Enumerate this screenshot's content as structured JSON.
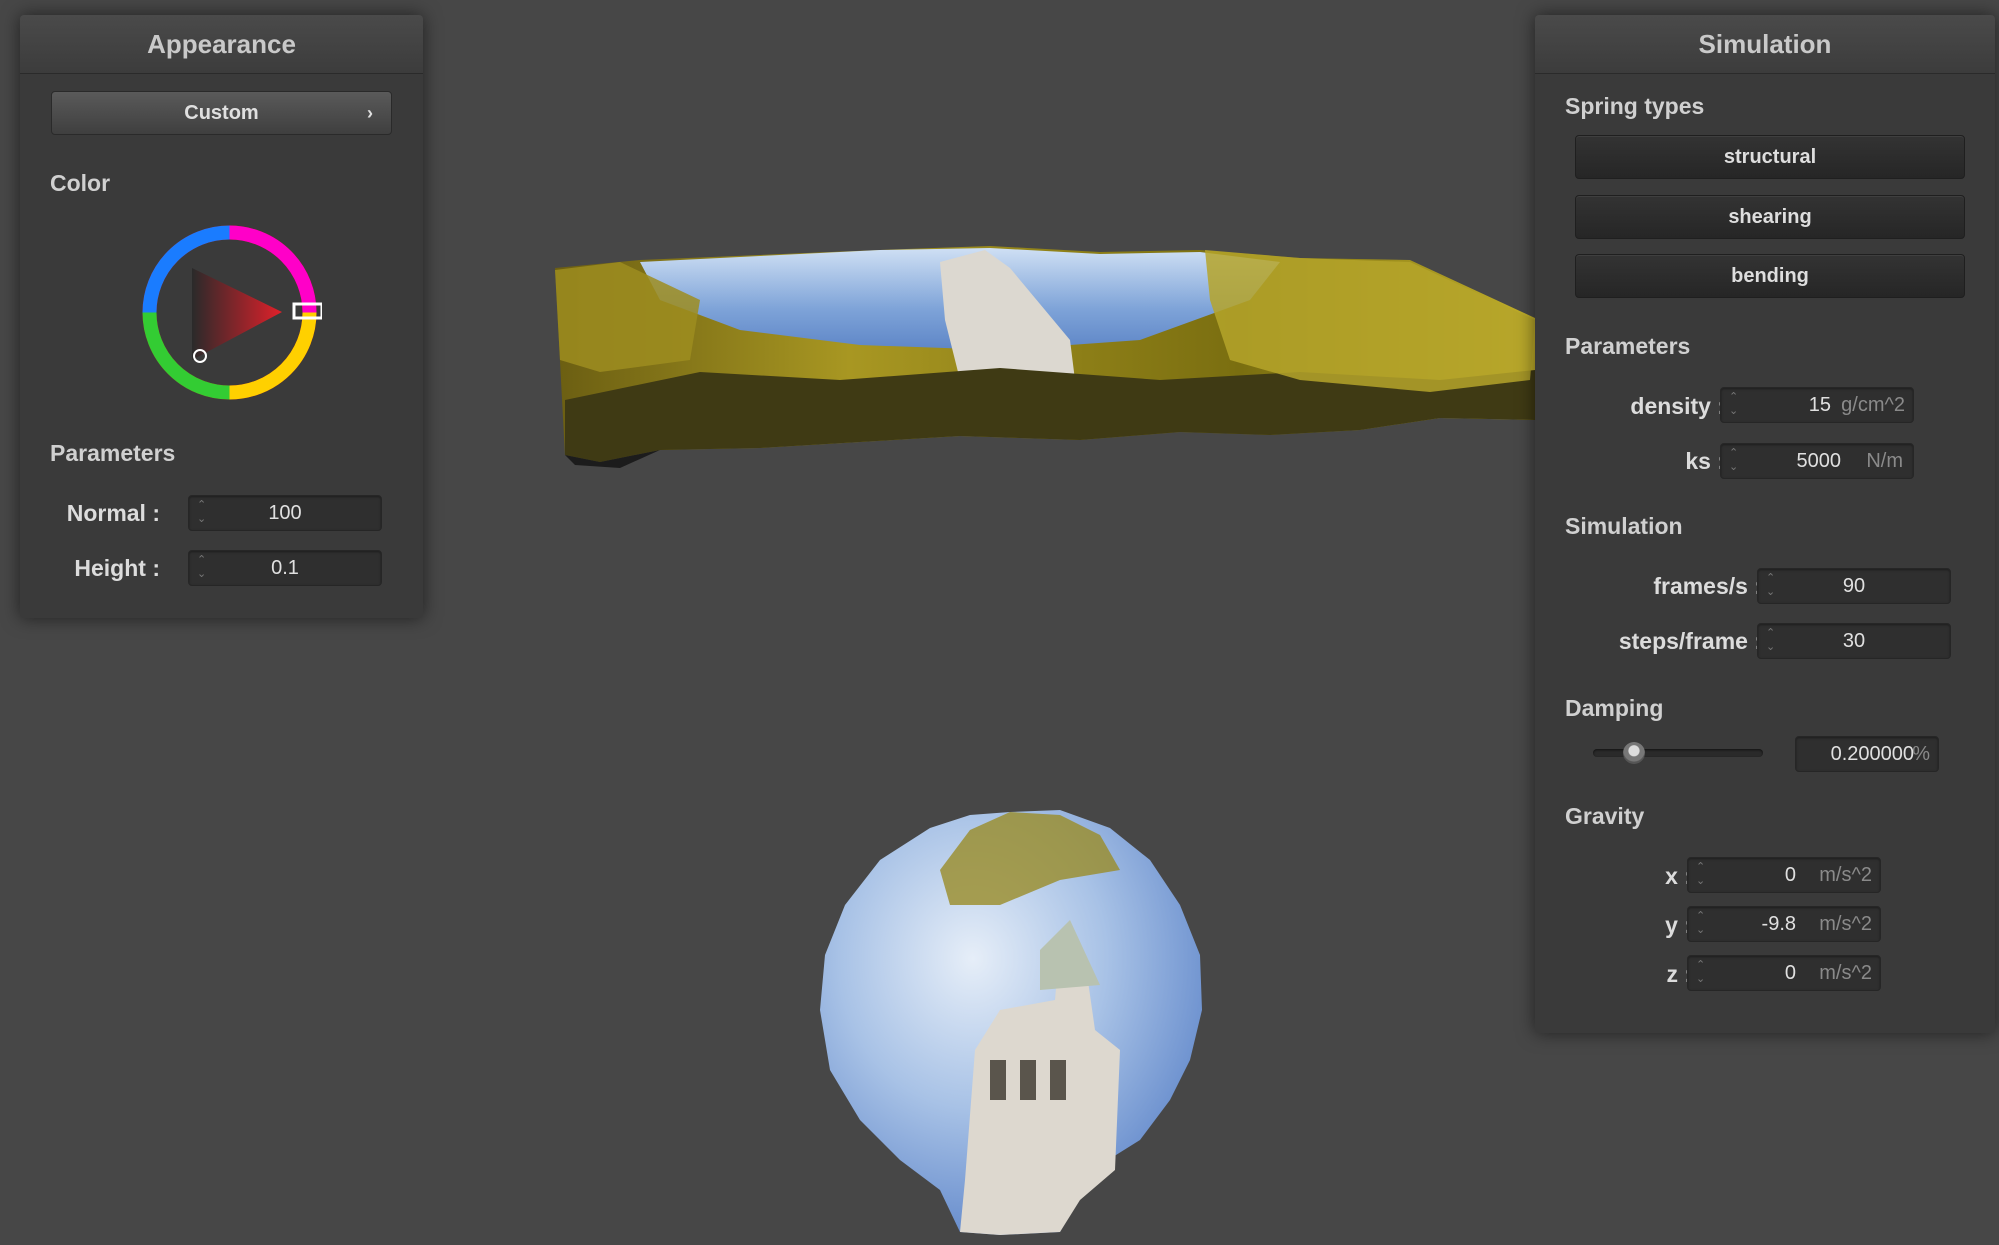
{
  "appearance": {
    "title": "Appearance",
    "preset": "Custom",
    "color_label": "Color",
    "parameters_label": "Parameters",
    "normal": {
      "label": "Normal :",
      "value": "100"
    },
    "height": {
      "label": "Height :",
      "value": "0.1"
    },
    "selected_hue": "#e0202a"
  },
  "simulation": {
    "title": "Simulation",
    "spring_types_label": "Spring types",
    "springs": [
      "structural",
      "shearing",
      "bending"
    ],
    "parameters_label": "Parameters",
    "density": {
      "label": "density :",
      "value": "15",
      "unit": "g/cm^2"
    },
    "ks": {
      "label": "ks :",
      "value": "5000",
      "unit": "N/m"
    },
    "sim_label": "Simulation",
    "fps": {
      "label": "frames/s :",
      "value": "90"
    },
    "steps": {
      "label": "steps/frame :",
      "value": "30"
    },
    "damping_label": "Damping",
    "damping": {
      "value": "0.200000",
      "unit": "%",
      "slider_fraction": 0.2
    },
    "gravity_label": "Gravity",
    "gx": {
      "label": "x :",
      "value": "0",
      "unit": "m/s^2"
    },
    "gy": {
      "label": "y :",
      "value": "-9.8",
      "unit": "m/s^2"
    },
    "gz": {
      "label": "z :",
      "value": "0",
      "unit": "m/s^2"
    }
  }
}
